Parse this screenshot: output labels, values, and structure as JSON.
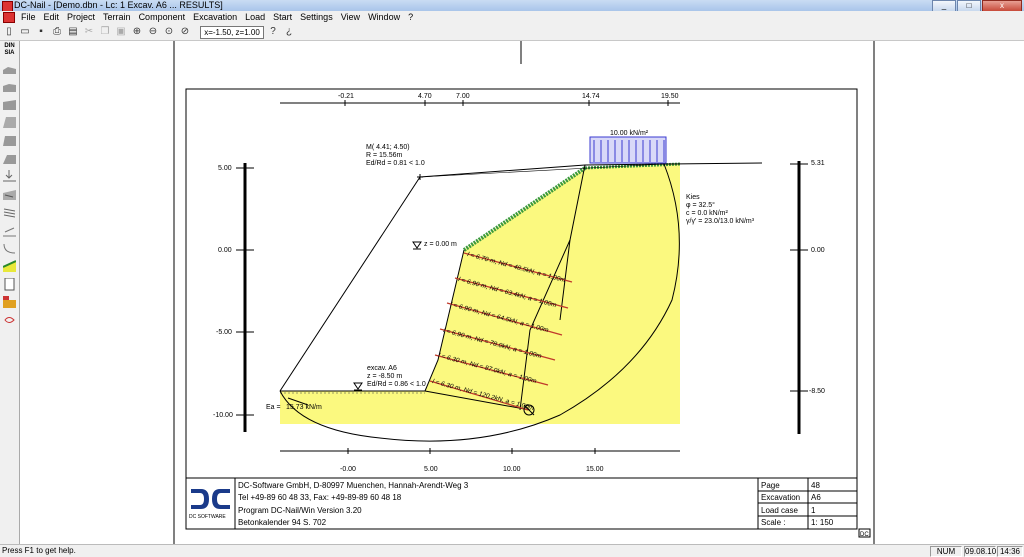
{
  "window": {
    "title": "DC-Nail - [Demo.dbn - Lc: 1 Excav. A6 ... RESULTS]",
    "minimize": "_",
    "maximize": "□",
    "close": "x"
  },
  "menu": [
    "File",
    "Edit",
    "Project",
    "Terrain",
    "Component",
    "Excavation",
    "Load",
    "Start",
    "Settings",
    "View",
    "Window",
    "?"
  ],
  "toolbar": {
    "coord": "x=-1.50, z=1.00"
  },
  "sidebar": {
    "sia_label": "DIN SIA"
  },
  "colors": {
    "soil": "#fbf97f",
    "nail": "#c0392b",
    "load": "#3a3ad0",
    "grass": "#3c9a3c"
  },
  "drawing": {
    "top_axis_ticks": [
      "-0.21",
      "4.70",
      "7.00",
      "14.74",
      "19.50"
    ],
    "left_axis_ticks": [
      "5.00",
      "0.00",
      "-5.00",
      "-10.00"
    ],
    "right_axis_ticks": [
      "5.31",
      "0.00",
      "-8.50"
    ],
    "bottom_axis_ticks": [
      "-0.00",
      "5.00",
      "10.00",
      "15.00"
    ],
    "circle_label": [
      "M( 4.41; 4.50)",
      "R = 15.56m",
      "Ed/Rd =  0.81 < 1.0"
    ],
    "load_label": "10.00 kN/m²",
    "soil_label": [
      "Kies",
      "φ      = 32.5°",
      "c      = 0.0 kN/m²",
      "γ/γ' = 23.0/13.0 kN/m³"
    ],
    "water_label": "z =  0.00 m",
    "excav_label": [
      "excav. A6",
      "z  = -8.50 m",
      "Ed/Rd =  0.86 < 1.0"
    ],
    "ea_label": [
      "Ea =",
      "15.73 kN/m"
    ],
    "nails": [
      "l = 6.70 m, Nd = 48.5kN, a = 1.00m",
      "l = 6.90 m, Nd = 63.4kN, a = 1.00m",
      "l = 6.90 m, Nd = 64.5kN, a = 1.00m",
      "l = 6.90 m, Nd = 78.0kN, a = 1.00m",
      "l = 6.30 m, Nd = 87.0kN, a = 1.00m",
      "l = 6.30 m, Nd = 120.2kN, a = 1.00m"
    ]
  },
  "title_block": {
    "logo_text": "DC SOFTWARE",
    "lines": [
      "DC-Software GmbH, D-80997 Muenchen, Hannah-Arendt-Weg 3",
      "Tel +49-89 60 48 33, Fax: +49-89-89 60 48 18",
      "Program DC-Nail/Win Version  3.20",
      "Betonkalender 94 S. 702"
    ],
    "fields": [
      {
        "label": "Page",
        "value": "48"
      },
      {
        "label": "Excavation",
        "value": "A6"
      },
      {
        "label": "Load case",
        "value": "1"
      },
      {
        "label": "Scale   :",
        "value": "1: 150"
      }
    ],
    "corner_tag": "DC"
  },
  "status": {
    "text": "Press F1 to get help.",
    "num": "NUM",
    "date": "09.08.10",
    "time": "14:36"
  }
}
